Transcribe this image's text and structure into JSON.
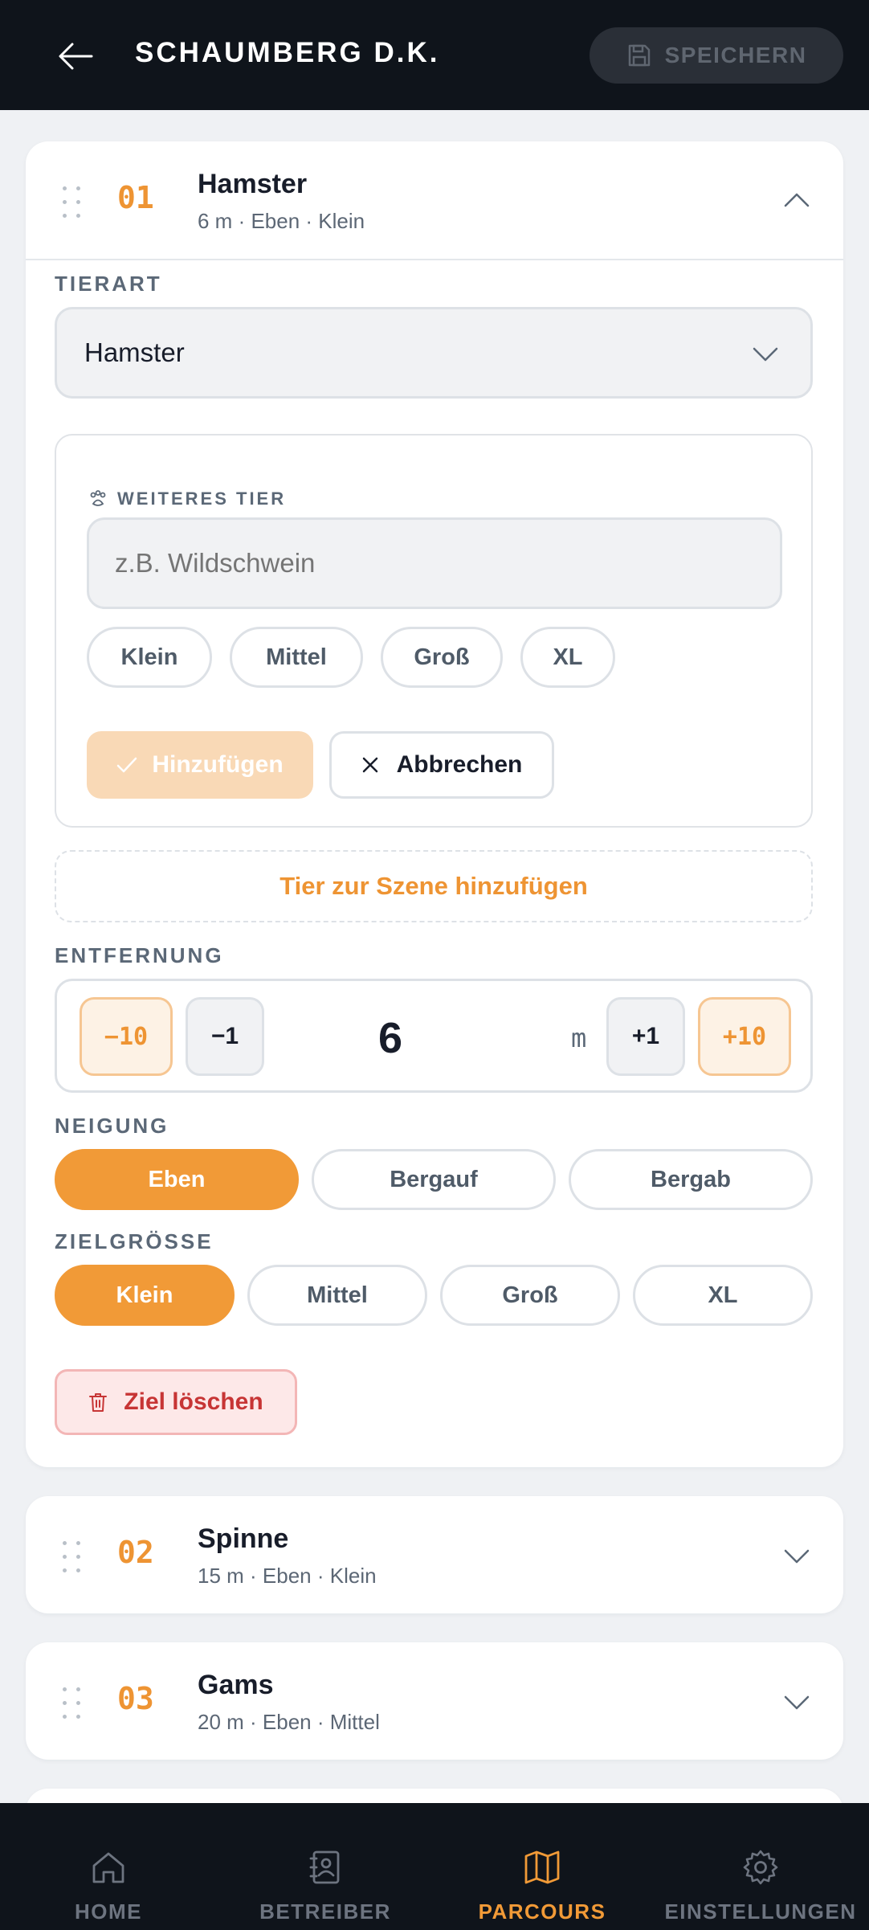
{
  "header": {
    "title": "SCHAUMBERG D.K.",
    "save_label": "SPEICHERN"
  },
  "targets": [
    {
      "number": "01",
      "name": "Hamster",
      "summary": "6 m · Eben · Klein",
      "expanded": true
    },
    {
      "number": "02",
      "name": "Spinne",
      "summary": "15 m · Eben · Klein",
      "expanded": false
    },
    {
      "number": "03",
      "name": "Gams",
      "summary": "20 m · Eben · Mittel",
      "expanded": false
    }
  ],
  "editor": {
    "species_label": "TIERART",
    "species_value": "Hamster",
    "extra_animal": {
      "label": "WEITERES TIER",
      "placeholder": "z.B. Wildschwein",
      "sizes": [
        "Klein",
        "Mittel",
        "Groß",
        "XL"
      ],
      "add_label": "Hinzufügen",
      "cancel_label": "Abbrechen"
    },
    "add_to_scene_label": "Tier zur Szene hinzufügen",
    "distance": {
      "label": "ENTFERNUNG",
      "minus10": "−10",
      "minus1": "−1",
      "value": "6",
      "unit": "m",
      "plus1": "+1",
      "plus10": "+10"
    },
    "slope": {
      "label": "NEIGUNG",
      "options": [
        "Eben",
        "Bergauf",
        "Bergab"
      ],
      "selected": "Eben"
    },
    "target_size": {
      "label": "ZIELGRÖSSE",
      "options": [
        "Klein",
        "Mittel",
        "Groß",
        "XL"
      ],
      "selected": "Klein"
    },
    "delete_label": "Ziel löschen"
  },
  "nav": {
    "items": [
      {
        "label": "HOME",
        "icon": "home-icon"
      },
      {
        "label": "BETREIBER",
        "icon": "contact-book-icon"
      },
      {
        "label": "PARCOURS",
        "icon": "map-icon"
      },
      {
        "label": "EINSTELLUNGEN",
        "icon": "gear-icon"
      }
    ],
    "active": "PARCOURS"
  },
  "colors": {
    "accent": "#f19a37",
    "header_bg": "#0f141b",
    "danger": "#c73535",
    "background": "#eff1f4"
  }
}
